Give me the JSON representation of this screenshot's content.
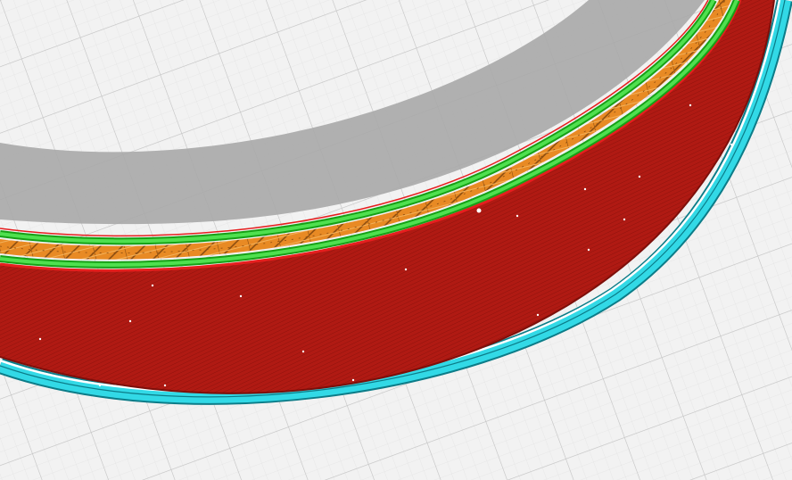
{
  "viewport": {
    "colors": {
      "bed_background": "#f2f2f2",
      "bed_minor_grid": "#e4e4e4",
      "bed_major_grid": "#c4c4c4",
      "inner_model_surface": "#a9a9a9",
      "outer_wall": "#b31b14",
      "outer_wall_outline": "#e61e1e",
      "inner_wall": "#22c722",
      "inner_wall_light": "#4fe04f",
      "infill": "#e88a24",
      "infill_lines": "#8a4c10",
      "skirt": "#32d9e6",
      "skirt_dark": "#0c7c88",
      "gap_white": "#ffffff"
    },
    "layers": [
      {
        "name": "build-plate-grid"
      },
      {
        "name": "model-inner-surface"
      },
      {
        "name": "skirt-line"
      },
      {
        "name": "outer-wall"
      },
      {
        "name": "inner-wall"
      },
      {
        "name": "infill"
      }
    ]
  }
}
